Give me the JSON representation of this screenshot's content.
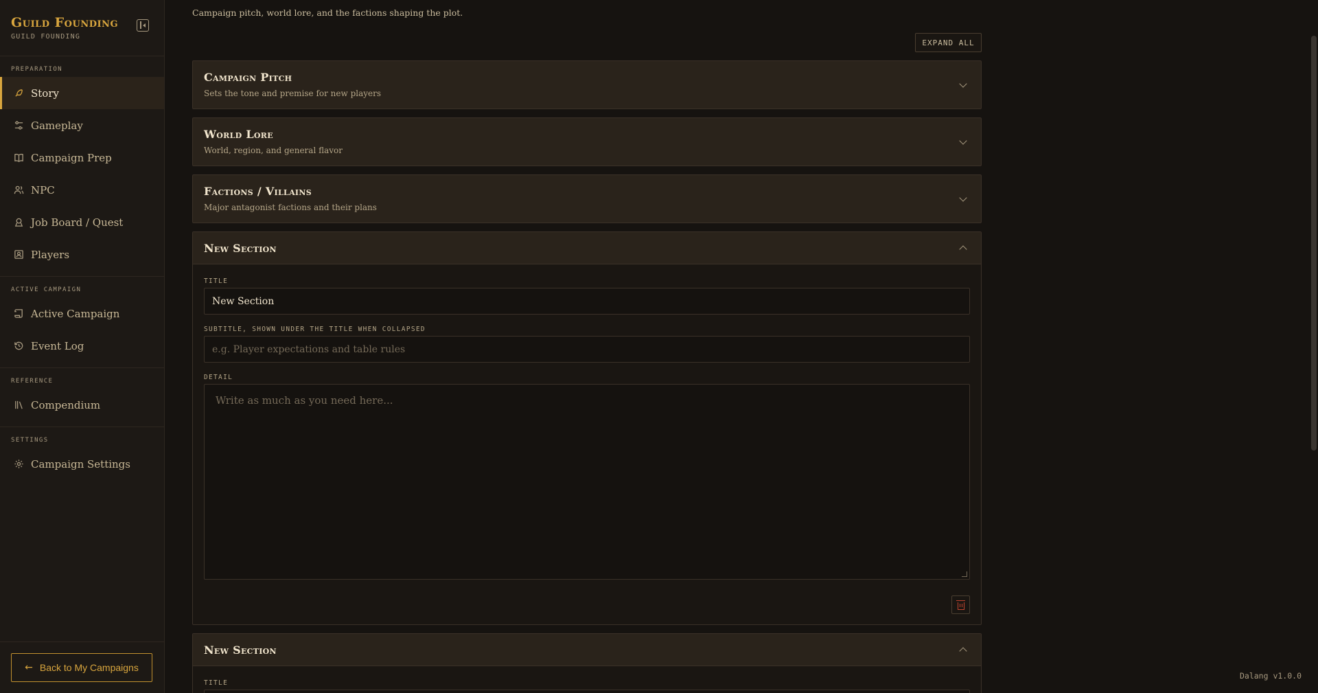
{
  "brand": {
    "title": "Guild Founding",
    "subtitle": "GUILD FOUNDING"
  },
  "nav": {
    "groups": [
      {
        "label": "PREPARATION",
        "items": [
          {
            "label": "Story",
            "icon": "feather-icon",
            "active": true
          },
          {
            "label": "Gameplay",
            "icon": "sliders-icon"
          },
          {
            "label": "Campaign Prep",
            "icon": "book-icon"
          },
          {
            "label": "NPC",
            "icon": "users-icon"
          },
          {
            "label": "Job Board / Quest",
            "icon": "badge-icon"
          },
          {
            "label": "Players",
            "icon": "contact-icon"
          }
        ]
      },
      {
        "label": "ACTIVE CAMPAIGN",
        "items": [
          {
            "label": "Active Campaign",
            "icon": "scroll-icon"
          },
          {
            "label": "Event Log",
            "icon": "history-icon"
          }
        ]
      },
      {
        "label": "REFERENCE",
        "items": [
          {
            "label": "Compendium",
            "icon": "library-icon"
          }
        ]
      },
      {
        "label": "SETTINGS",
        "items": [
          {
            "label": "Campaign Settings",
            "icon": "gear-icon"
          }
        ]
      }
    ],
    "back_label": "Back to My Campaigns"
  },
  "main": {
    "intro": "Campaign pitch, world lore, and the factions shaping the plot.",
    "expand_all": "EXPAND ALL",
    "sections": [
      {
        "title": "Campaign Pitch",
        "subtitle": "Sets the tone and premise for new players"
      },
      {
        "title": "World Lore",
        "subtitle": "World, region, and general flavor"
      },
      {
        "title": "Factions / Villains",
        "subtitle": "Major antagonist factions and their plans"
      }
    ],
    "editor": {
      "title": "New Section",
      "title_label": "TITLE",
      "title_value": "New Section",
      "subtitle_label": "SUBTITLE, SHOWN UNDER THE TITLE WHEN COLLAPSED",
      "subtitle_placeholder": "e.g. Player expectations and table rules",
      "detail_label": "DETAIL",
      "detail_placeholder": "Write as much as you need here..."
    },
    "editor2": {
      "title": "New Section",
      "title_label": "TITLE"
    }
  },
  "version": "Dalang v1.0.0",
  "colors": {
    "accent": "#d9a63e",
    "danger": "#c2452f",
    "background": "#161310"
  }
}
